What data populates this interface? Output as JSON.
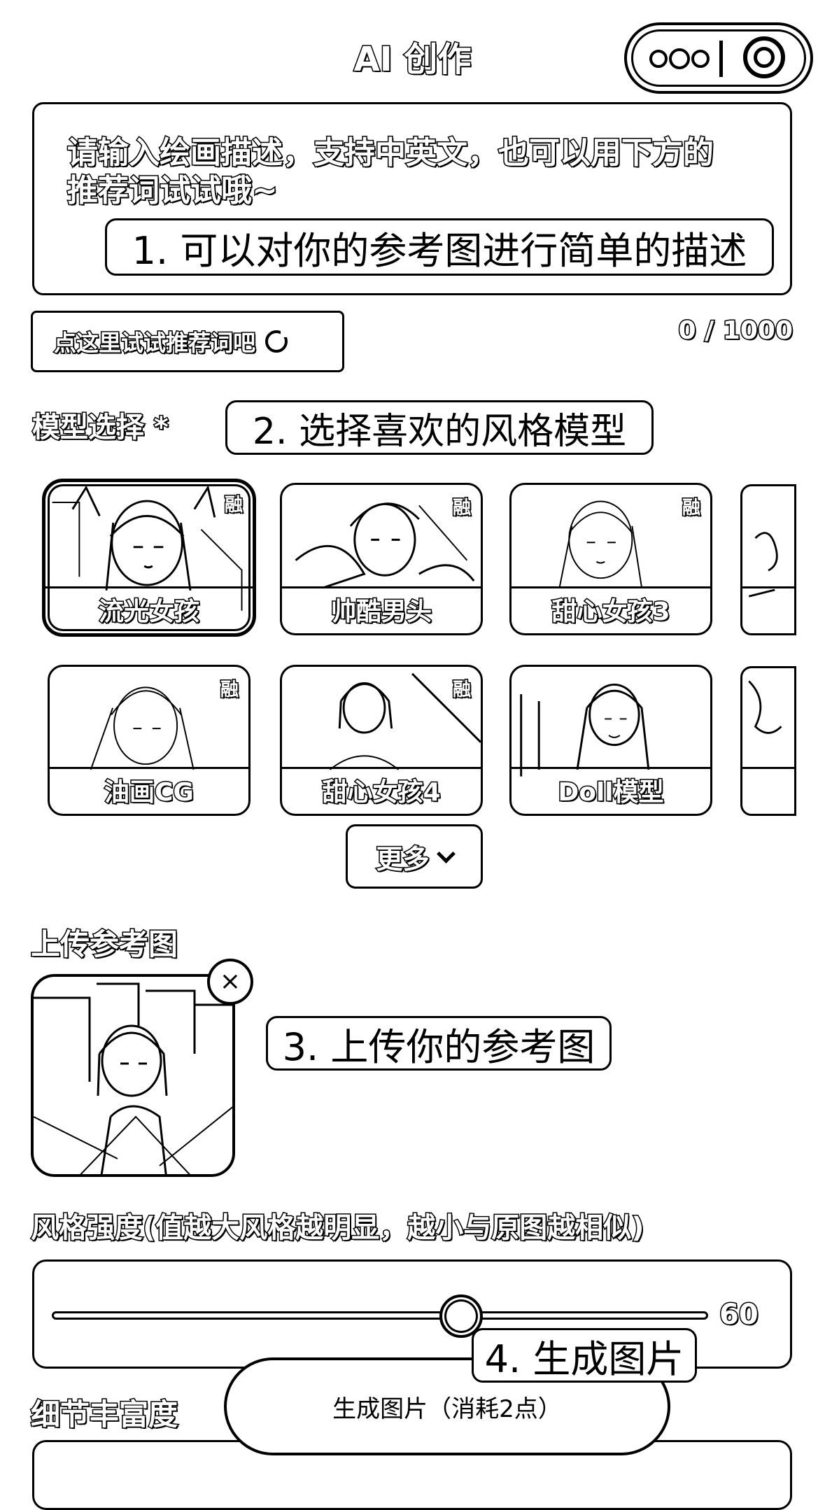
{
  "header": {
    "title": "AI 创作",
    "capsule": {
      "more_icon": "more-dots-icon",
      "close_icon": "target-icon"
    }
  },
  "prompt": {
    "placeholder": "请输入绘画描述，支持中英文，也可以用下方的推荐词试试哦~",
    "counter": "0 / 1000"
  },
  "recommend": {
    "label": "点这里试试推荐词吧",
    "icon": "refresh-icon"
  },
  "models": {
    "label": "模型选择 *",
    "badge": "融",
    "items": [
      {
        "name": "流光女孩",
        "selected": true
      },
      {
        "name": "帅酷男头",
        "selected": false
      },
      {
        "name": "甜心女孩3",
        "selected": false
      },
      {
        "name": "",
        "selected": false
      },
      {
        "name": "油画CG",
        "selected": false
      },
      {
        "name": "甜心女孩4",
        "selected": false
      },
      {
        "name": "Doll模型",
        "selected": false
      },
      {
        "name": "",
        "selected": false
      }
    ],
    "more_label": "更多"
  },
  "upload": {
    "label": "上传参考图",
    "close_icon": "close-icon"
  },
  "strength": {
    "label": "风格强度(值越大风格越明显，越小与原图越相似)",
    "value": 60,
    "max": 100
  },
  "detail": {
    "label": "细节丰富度"
  },
  "generate": {
    "label": "生成图片（消耗2点）"
  },
  "callouts": {
    "c1": "1. 可以对你的参考图进行简单的描述",
    "c2": "2. 选择喜欢的风格模型",
    "c3": "3. 上传你的参考图",
    "c4": "4. 生成图片"
  }
}
